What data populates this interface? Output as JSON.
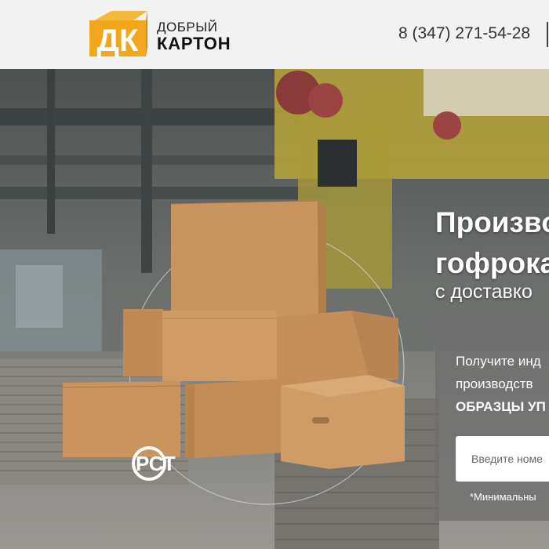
{
  "header": {
    "logo": {
      "monogram": "ДК",
      "line1": "ДОБРЫЙ",
      "line2": "КАРТОН"
    },
    "phone": "8 (347) 271-54-28"
  },
  "hero": {
    "title_line1": "Произво",
    "title_line2": "гофрока",
    "subtitle": "с доставко",
    "form": {
      "text_line1": "Получите инд",
      "text_line2": "производств",
      "text_line3": "ОБРАЗЦЫ УП",
      "input_placeholder": "Введите номе",
      "note": "*Минимальны"
    },
    "certification_mark": "РСТ"
  },
  "colors": {
    "logo_orange": "#f2a61c",
    "logo_orange_dark": "#d98a0a",
    "header_bg": "#f2f2f2",
    "cardboard": "#c9955f"
  }
}
